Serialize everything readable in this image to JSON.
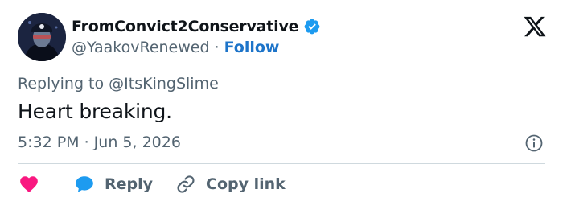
{
  "author": {
    "display_name": "FromConvict2Conservative",
    "handle": "@YaakovRenewed",
    "separator": "·",
    "follow_label": "Follow"
  },
  "tweet": {
    "replying_to_prefix": "Replying to",
    "replying_to_handle": "@ItsKingSlime",
    "text": "Heart breaking.",
    "timestamp": "5:32 PM · Jun 5, 2026"
  },
  "actions": {
    "reply_label": "Reply",
    "copy_link_label": "Copy link"
  },
  "icons": {
    "verified": "verified-badge-icon",
    "logo": "x-logo-icon",
    "info": "info-icon",
    "like": "heart-icon",
    "reply": "speech-bubble-icon",
    "copy_link": "link-icon"
  },
  "colors": {
    "brand_blue": "#1d9bf0",
    "follow_blue": "#1d74c9",
    "heart_red": "#f91880",
    "text_primary": "#0f1419",
    "text_secondary": "#536471",
    "divider": "#cfd9de"
  }
}
